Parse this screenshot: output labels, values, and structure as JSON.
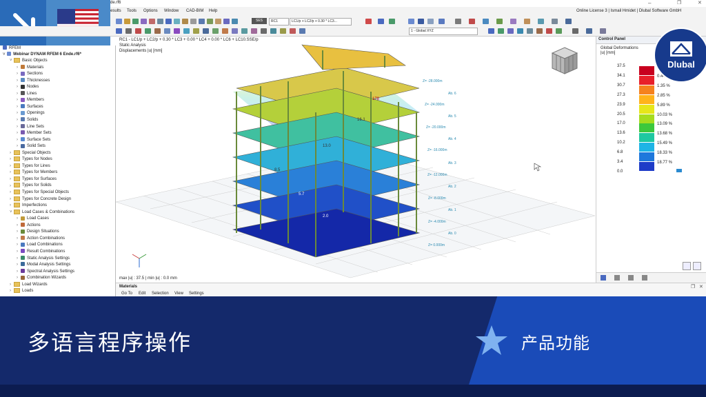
{
  "window": {
    "title_fragment": "de.rf6",
    "license_text": "Online License 3 | Ismail Hmidet | Dlubal Software GmbH"
  },
  "menu": [
    "esults",
    "Tools",
    "Options",
    "Window",
    "CAD-BIM",
    "Help"
  ],
  "toolbar": {
    "combo_ses": "SES",
    "combo_rc": "RC1",
    "combo_formula": "LC1/p + LC2/p + 0.30 * LC3...",
    "view_combo": "1 - Global XYZ"
  },
  "tree": {
    "root": "RFEM",
    "project": "Webinar DYNAM RFEM 6 Ende.rf6*",
    "items": [
      {
        "label": "Basic Objects",
        "level": 1,
        "type": "folder",
        "open": true
      },
      {
        "label": "Materials",
        "level": 2,
        "type": "item",
        "color": "#c07a3a"
      },
      {
        "label": "Sections",
        "level": 2,
        "type": "item",
        "color": "#7a6ac0"
      },
      {
        "label": "Thicknesses",
        "level": 2,
        "type": "item",
        "color": "#5a8ac0"
      },
      {
        "label": "Nodes",
        "level": 2,
        "type": "item",
        "color": "#333333"
      },
      {
        "label": "Lines",
        "level": 2,
        "type": "item",
        "color": "#555555"
      },
      {
        "label": "Members",
        "level": 2,
        "type": "item",
        "color": "#8a5ac0"
      },
      {
        "label": "Surfaces",
        "level": 2,
        "type": "item",
        "color": "#4a7ac0"
      },
      {
        "label": "Openings",
        "level": 2,
        "type": "item",
        "color": "#6a9ad0"
      },
      {
        "label": "Solids",
        "level": 2,
        "type": "item",
        "color": "#5a7ab0"
      },
      {
        "label": "Line Sets",
        "level": 2,
        "type": "item",
        "color": "#6a6a9a"
      },
      {
        "label": "Member Sets",
        "level": 2,
        "type": "item",
        "color": "#7a5ab0"
      },
      {
        "label": "Surface Sets",
        "level": 2,
        "type": "item",
        "color": "#5a8ad0"
      },
      {
        "label": "Solid Sets",
        "level": 2,
        "type": "item",
        "color": "#4a6aa0"
      },
      {
        "label": "Special Objects",
        "level": 1,
        "type": "folder",
        "open": false
      },
      {
        "label": "Types for Nodes",
        "level": 1,
        "type": "folder",
        "open": false
      },
      {
        "label": "Types for Lines",
        "level": 1,
        "type": "folder",
        "open": false
      },
      {
        "label": "Types for Members",
        "level": 1,
        "type": "folder",
        "open": false
      },
      {
        "label": "Types for Surfaces",
        "level": 1,
        "type": "folder",
        "open": false
      },
      {
        "label": "Types for Solids",
        "level": 1,
        "type": "folder",
        "open": false
      },
      {
        "label": "Types for Special Objects",
        "level": 1,
        "type": "folder",
        "open": false
      },
      {
        "label": "Types for Concrete Design",
        "level": 1,
        "type": "folder",
        "open": false
      },
      {
        "label": "Imperfections",
        "level": 1,
        "type": "folder",
        "open": false
      },
      {
        "label": "Load Cases & Combinations",
        "level": 1,
        "type": "folder",
        "open": true
      },
      {
        "label": "Load Cases",
        "level": 2,
        "type": "item",
        "color": "#c09a3a"
      },
      {
        "label": "Actions",
        "level": 2,
        "type": "item",
        "color": "#c06a3a"
      },
      {
        "label": "Design Situations",
        "level": 2,
        "type": "item",
        "color": "#6a8a3a"
      },
      {
        "label": "Action Combinations",
        "level": 2,
        "type": "item",
        "color": "#c07a4a"
      },
      {
        "label": "Load Combinations",
        "level": 2,
        "type": "item",
        "color": "#4a7ac0"
      },
      {
        "label": "Result Combinations",
        "level": 2,
        "type": "item",
        "color": "#7a4ac0"
      },
      {
        "label": "Static Analysis Settings",
        "level": 2,
        "type": "item",
        "color": "#3a8a6a"
      },
      {
        "label": "Modal Analysis Settings",
        "level": 2,
        "type": "item",
        "color": "#3a6a9a"
      },
      {
        "label": "Spectral Analysis Settings",
        "level": 2,
        "type": "item",
        "color": "#6a3a9a"
      },
      {
        "label": "Combination Wizards",
        "level": 2,
        "type": "item",
        "color": "#9a6a3a"
      },
      {
        "label": "Load Wizards",
        "level": 1,
        "type": "folder",
        "open": false
      },
      {
        "label": "Loads",
        "level": 1,
        "type": "folder",
        "open": false
      }
    ]
  },
  "viewport": {
    "line1": "RC1 - LC1/p + LC2/p + 0.30 * LC3 + 0.00 * LC4 + 0.00 * LC6 + LC10.SSE/p",
    "line2": "Static Analysis",
    "line3": "Displacements |u| [mm]",
    "footer": "max |u| : 37.5 | min |u| : 0.0 mm",
    "level_labels": [
      "Z= -28.000m",
      "Z= -24.000m",
      "Z= -20.000m",
      "Z= -16.000m",
      "Z= -12.000m",
      "Z= -8.000m",
      "Z= -4.000m",
      "Z= 0.000m"
    ],
    "storey_labels": [
      "Ab. 6",
      "Ab. 5",
      "Ab. 4",
      "Ab. 3",
      "Ab. 2",
      "Ab. 1",
      "Ab. 0"
    ],
    "value_labels": [
      "178",
      "16.1",
      "13.0",
      "8.5",
      "5.7",
      "2.0"
    ]
  },
  "control_panel": {
    "title": "Control Panel",
    "subtitle": "Global Deformations",
    "unit": "|u| [mm]",
    "legend": [
      {
        "value": "37.5",
        "color": "#c8001e",
        "percent": ""
      },
      {
        "value": "34.1",
        "color": "#e8202a",
        "percent": "0.44 %"
      },
      {
        "value": "30.7",
        "color": "#f5821e",
        "percent": "1.35 %"
      },
      {
        "value": "27.3",
        "color": "#ffb31a",
        "percent": "2.85 %"
      },
      {
        "value": "23.9",
        "color": "#e6e61a",
        "percent": "5.89 %"
      },
      {
        "value": "20.5",
        "color": "#a6dc1e",
        "percent": "10.03 %"
      },
      {
        "value": "17.0",
        "color": "#3cc83c",
        "percent": "13.09 %"
      },
      {
        "value": "13.6",
        "color": "#1ec8a0",
        "percent": "13.68 %"
      },
      {
        "value": "10.2",
        "color": "#1eb4e6",
        "percent": "15.49 %"
      },
      {
        "value": "6.8",
        "color": "#1e78dc",
        "percent": "18.33 %"
      },
      {
        "value": "3.4",
        "color": "#1e3cc8",
        "percent": "18.77 %"
      },
      {
        "value": "0.0",
        "color": "#0a1496",
        "percent": ""
      }
    ]
  },
  "materials_panel": {
    "title": "Materials",
    "menu": [
      "Go To",
      "Edit",
      "Selection",
      "View",
      "Settings"
    ]
  },
  "banner": {
    "title": "多语言程序操作",
    "subtitle": "产品功能"
  },
  "badge": {
    "text": "Dlubal"
  }
}
